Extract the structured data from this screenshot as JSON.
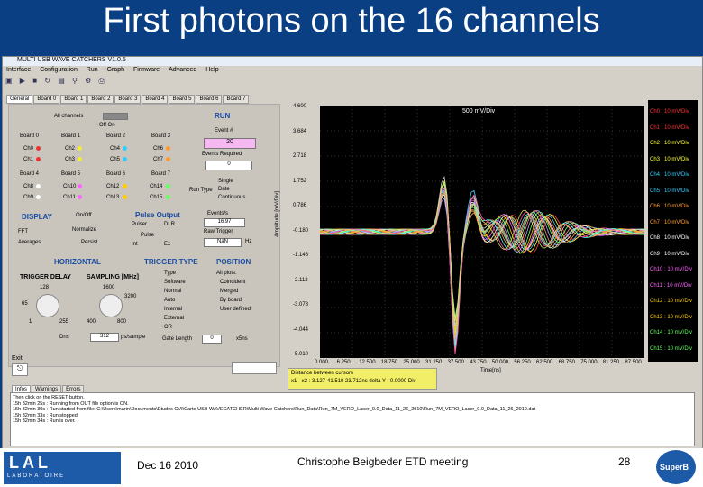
{
  "slide": {
    "title": "First photons on the 16 channels",
    "date": "Dec 16 2010",
    "presenter": "Christophe Beigbeder ETD meeting",
    "page": "28",
    "logo_lab": "LABORATOIRE",
    "logo_superb": "SuperB"
  },
  "app": {
    "title": "MULTI USB WAVE CATCHERS V1.0.5",
    "menu": [
      "Interface",
      "Configuration",
      "Run",
      "Graph",
      "Firmware",
      "Advanced",
      "Help"
    ],
    "tabs": [
      "General",
      "Board 0",
      "Board 1",
      "Board 2",
      "Board 3",
      "Board 4",
      "Board 5",
      "Board 6",
      "Board 7"
    ],
    "all_channels": "All channels",
    "off_on": "Off On",
    "run": "RUN",
    "event_label": "Event #",
    "event_value": "20",
    "events_required": "Events Required",
    "events_required_value": "0",
    "run_type": "Run Type",
    "run_options": [
      "Single",
      "Date",
      "Continuous"
    ],
    "boards": [
      {
        "name": "Board 0",
        "channels": [
          "Ch0",
          "Ch1"
        ]
      },
      {
        "name": "Board 1",
        "channels": [
          "Ch2",
          "Ch3"
        ]
      },
      {
        "name": "Board 2",
        "channels": [
          "Ch4",
          "Ch5"
        ]
      },
      {
        "name": "Board 3",
        "channels": [
          "Ch6",
          "Ch7"
        ]
      },
      {
        "name": "Board 4",
        "channels": [
          "Ch8",
          "Ch9"
        ]
      },
      {
        "name": "Board 5",
        "channels": [
          "Ch10",
          "Ch11"
        ]
      },
      {
        "name": "Board 6",
        "channels": [
          "Ch12",
          "Ch13"
        ]
      },
      {
        "name": "Board 7",
        "channels": [
          "Ch14",
          "Ch15"
        ]
      }
    ],
    "display": "DISPLAY",
    "on_off": "On/Off",
    "fft": "FFT",
    "averages": "Averages",
    "normalize": "Normalize",
    "persist": "Persist",
    "pulse_output": "Pulse Output",
    "pulser": "Pulser",
    "dlr": "DLR",
    "pulse": "Pulse",
    "int": "Int",
    "ex": "Ex",
    "events_s": "Events/s",
    "events_s_value": "16.97",
    "raw_trigger": "Raw Trigger",
    "raw_trigger_value": "NaN",
    "hz": "Hz",
    "horizontal": "HORIZONTAL",
    "trigger_type": "TRIGGER TYPE",
    "position": "POSITION",
    "trigger_delay": "TRIGGER DELAY",
    "sampling": "SAMPLING [MHz]",
    "knob1_ticks": [
      "128",
      "65",
      "1",
      "255"
    ],
    "knob2_ticks": [
      "1600",
      "3200",
      "400",
      "800"
    ],
    "type_label": "Type",
    "types": [
      "Software",
      "Normal",
      "Auto",
      "Internal",
      "External",
      "OR"
    ],
    "all_plots": "All plots:",
    "plots": [
      "Coincident",
      "Merged",
      "By board",
      "User defined"
    ],
    "dns": "Dns",
    "ps_sample": "ps/sample",
    "gate_length": "Gate Length",
    "ns": "x5ns",
    "sample_val": "312",
    "gate_val": "0",
    "exit": "Exit",
    "bottom_tabs": [
      "Infos",
      "Warnings",
      "Errors"
    ],
    "log": [
      "Then click on the RESET button.",
      "15h 32min 25s : Running from OUT file option is ON.",
      "15h 32min 30s : Run started from file: C:\\Users\\marin\\Documents\\Etudes CVI\\Carte USB WAVECATCHER\\Multi Wave Catchers\\Run_Data\\Run_7M_VERO_Laser_0.0_Data_11_26_2010\\Run_7M_VERO_Laser_0.0_Data_11_26_2010.dat",
      "15h 32min 33s : Run stopped.",
      "15h 32min 34s : Run is over."
    ],
    "plot_title": "500 mV/Div",
    "y_label": "Amplitude [mV/Div]",
    "x_label": "Time[ns]",
    "y_ticks": [
      "4.600",
      "3.684",
      "2.718",
      "1.752",
      "0.786",
      "-0.180",
      "-1.146",
      "-2.112",
      "-3.078",
      "-4.044",
      "-5.010"
    ],
    "x_ticks": [
      "0.000",
      "6.250",
      "12.500",
      "18.750",
      "25.000",
      "31.250",
      "37.500",
      "43.750",
      "50.000",
      "56.250",
      "62.500",
      "68.750",
      "75.000",
      "81.250",
      "87.500"
    ],
    "x_tick_display": [
      "0.000",
      "6.250",
      "12.500",
      "18.750",
      "25.000",
      "31.250",
      "37.500",
      "43.750",
      "50.000",
      "56.250",
      "62.500",
      "68.750",
      "75.000",
      "81.250",
      "87.500"
    ],
    "legend": [
      {
        "text": "Ch0 : 10 mV/Div",
        "color": "#ff3333"
      },
      {
        "text": "Ch1 : 10 mV/Div",
        "color": "#ff3333"
      },
      {
        "text": "Ch2 : 10 mV/Div",
        "color": "#ffff33"
      },
      {
        "text": "Ch3 : 10 mV/Div",
        "color": "#ffff33"
      },
      {
        "text": "Ch4 : 10 mV/Div",
        "color": "#33ccff"
      },
      {
        "text": "Ch5 : 10 mV/Div",
        "color": "#33ccff"
      },
      {
        "text": "Ch6 : 10 mV/Div",
        "color": "#ff9933"
      },
      {
        "text": "Ch7 : 10 mV/Div",
        "color": "#ff9933"
      },
      {
        "text": "Ch8 : 10 mV/Div",
        "color": "#ffffff"
      },
      {
        "text": "Ch9 : 10 mV/Div",
        "color": "#ffffff"
      },
      {
        "text": "Ch10 : 10 mV/Div",
        "color": "#ff66ff"
      },
      {
        "text": "Ch11 : 10 mV/Div",
        "color": "#ff66ff"
      },
      {
        "text": "Ch12 : 10 mV/Div",
        "color": "#ffcc00"
      },
      {
        "text": "Ch13 : 10 mV/Div",
        "color": "#ffcc00"
      },
      {
        "text": "Ch14 : 10 mV/Div",
        "color": "#66ff66"
      },
      {
        "text": "Ch15 : 10 mV/Div",
        "color": "#66ff66"
      }
    ],
    "cursor_title": "Distance between cursors",
    "cursor_text": "x1 - x2 : 3.127-41.510 23.712ns delta Y : 0.0000 Div",
    "colors": {
      "trace_colors": [
        "#ff4444",
        "#ffff44",
        "#44ccff",
        "#ff9933",
        "#ffffff",
        "#ff66ff",
        "#ffcc00",
        "#66ff66",
        "#aaaaff",
        "#ff8888",
        "#88ff88",
        "#cccccc",
        "#ffaa55",
        "#55ffff",
        "#ff55aa",
        "#dddd55"
      ]
    }
  }
}
